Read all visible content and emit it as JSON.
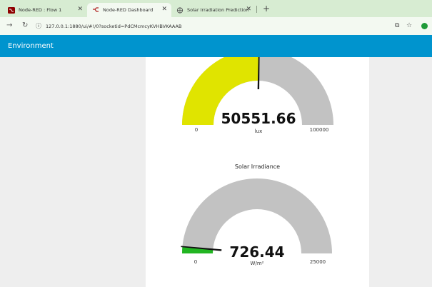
{
  "browser": {
    "tabs": [
      {
        "title": "Node-RED : Flow 1",
        "active": false
      },
      {
        "title": "Node-RED Dashboard",
        "active": true
      },
      {
        "title": "Solar Irradiation Prediction",
        "active": false
      }
    ],
    "url": "127.0.0.1:1880/ui/#!/0?socketid=PdCMcmcyKVHBVKAAAB"
  },
  "dashboard": {
    "header_title": "Environment",
    "gauges": [
      {
        "title": "",
        "value": 50551.66,
        "value_text": "50551.66",
        "unit": "lux",
        "min": 0,
        "max": 100000,
        "min_label": "0",
        "max_label": "100000",
        "fill_color": "#e0e400",
        "track_color": "#c2c2c2"
      },
      {
        "title": "Solar Irradiance",
        "value": 726.44,
        "value_text": "726.44",
        "unit": "W/m²",
        "min": 0,
        "max": 25000,
        "min_label": "0",
        "max_label": "25000",
        "fill_color": "#22b522",
        "track_color": "#c2c2c2"
      }
    ]
  }
}
